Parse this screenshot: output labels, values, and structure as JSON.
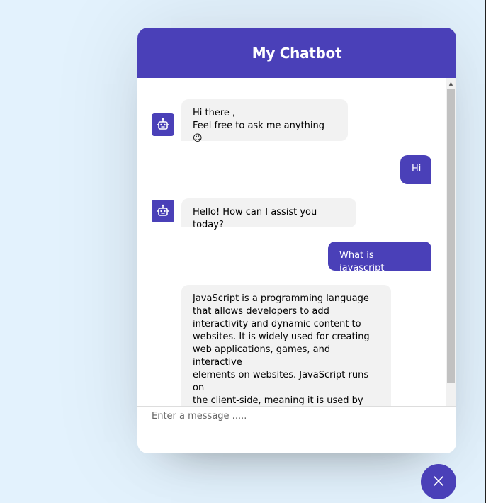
{
  "header": {
    "title": "My Chatbot"
  },
  "messages": [
    {
      "role": "incoming",
      "text": "Hi there ,\nFeel free to ask me anything 😉"
    },
    {
      "role": "outgoing",
      "text": "Hi"
    },
    {
      "role": "incoming",
      "text": "Hello! How can I assist you today?"
    },
    {
      "role": "outgoing",
      "text": "What is javascript"
    },
    {
      "role": "incoming",
      "text": "JavaScript is a programming language\nthat allows developers to add\ninteractivity and dynamic content to\nwebsites. It is widely used for creating\nweb applications, games, and interactive\nelements on websites. JavaScript runs on\nthe client-side, meaning it is used by the\nweb browser to manipulate web page\nelements, handle user input, and"
    }
  ],
  "input": {
    "placeholder": "Enter a message ....."
  },
  "icons": {
    "bot": "robot-icon",
    "close": "close-icon",
    "scroll_up": "scroll-up-arrow-icon"
  },
  "colors": {
    "accent": "#4a40b8",
    "incoming_bg": "#f2f2f2",
    "page_bg": "#e3f2fd"
  }
}
